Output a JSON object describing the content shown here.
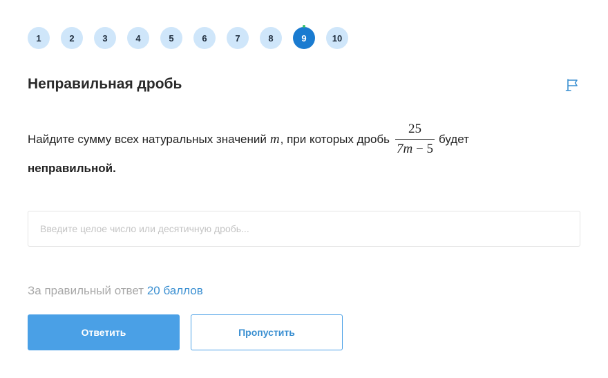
{
  "steps": [
    {
      "label": "1"
    },
    {
      "label": "2"
    },
    {
      "label": "3"
    },
    {
      "label": "4"
    },
    {
      "label": "5"
    },
    {
      "label": "6"
    },
    {
      "label": "7"
    },
    {
      "label": "8"
    },
    {
      "label": "9",
      "active": true
    },
    {
      "label": "10"
    }
  ],
  "task": {
    "title": "Неправильная дробь",
    "flag_icon": "flag-icon",
    "question": {
      "text_before": "Найдите сумму всех натуральных значений",
      "variable": "m",
      "text_middle": ", при которых дробь",
      "fraction": {
        "numerator": "25",
        "denominator_var": "7m",
        "denominator_rest": " − 5"
      },
      "text_after": "будет",
      "text_bold": "неправильной."
    }
  },
  "answer": {
    "placeholder": "Введите целое число или десятичную дробь..."
  },
  "reward": {
    "label": "За правильный ответ",
    "value": "20 баллов"
  },
  "buttons": {
    "submit": "Ответить",
    "skip": "Пропустить"
  },
  "colors": {
    "accent": "#4aa0e6",
    "active_step": "#1a7bd0",
    "step_bg": "#cfe6fa",
    "link": "#3a8fd1"
  }
}
